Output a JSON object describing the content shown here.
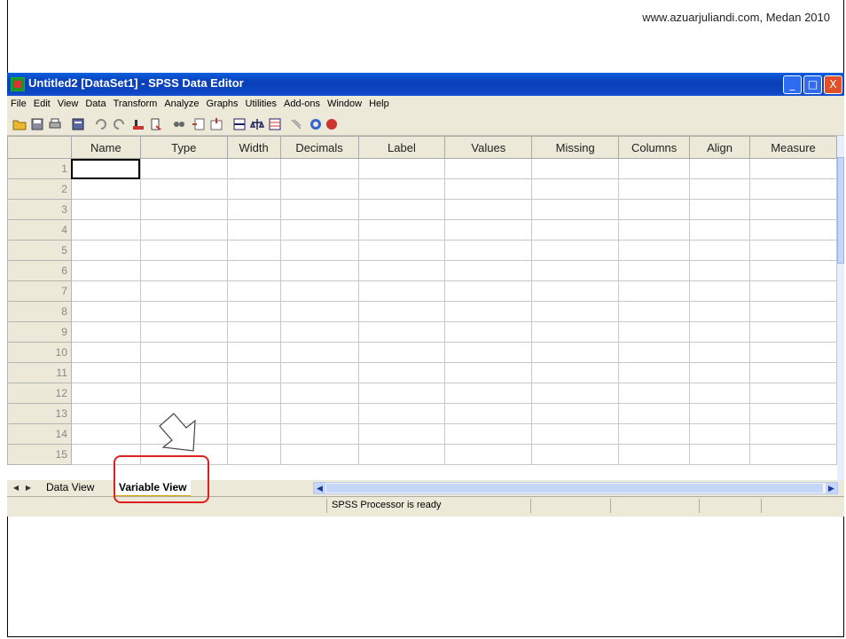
{
  "watermark": "www.azuarjuliandi.com, Medan 2010",
  "window": {
    "title": "Untitled2 [DataSet1] - SPSS Data Editor",
    "minimize": "_",
    "maximize": "□",
    "close": "X"
  },
  "menu": [
    "File",
    "Edit",
    "View",
    "Data",
    "Transform",
    "Analyze",
    "Graphs",
    "Utilities",
    "Add-ons",
    "Window",
    "Help"
  ],
  "toolbar_icons": [
    "open-icon",
    "save-icon",
    "print-icon",
    "dialog-recall-icon",
    "undo-icon",
    "redo-icon",
    "goto-case-icon",
    "variables-icon",
    "find-icon",
    "insert-cases-icon",
    "insert-variable-icon",
    "split-file-icon",
    "weight-cases-icon",
    "select-cases-icon",
    "value-labels-icon",
    "use-sets-icon",
    "show-all-variables-icon"
  ],
  "grid": {
    "columns": [
      "Name",
      "Type",
      "Width",
      "Decimals",
      "Label",
      "Values",
      "Missing",
      "Columns",
      "Align",
      "Measure"
    ],
    "rows": [
      "1",
      "2",
      "3",
      "4",
      "5",
      "6",
      "7",
      "8",
      "9",
      "10",
      "11",
      "12",
      "13",
      "14",
      "15"
    ]
  },
  "tabs": {
    "data_view": "Data View",
    "variable_view": "Variable View"
  },
  "status": "SPSS Processor is ready",
  "colors": {
    "titlebar": "#0a4fd0",
    "highlight": "#e02020",
    "chrome": "#ece9d8"
  }
}
